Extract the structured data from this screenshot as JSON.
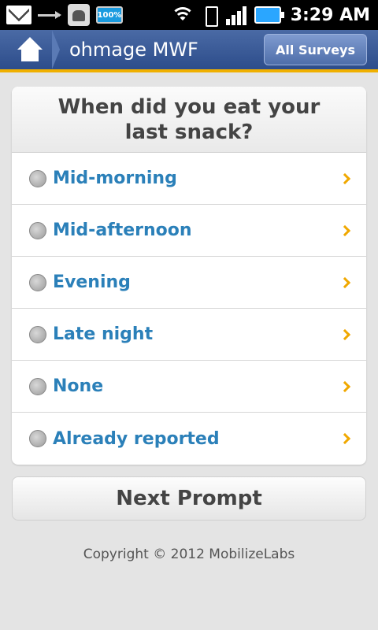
{
  "status_bar": {
    "time": "3:29 AM",
    "battery_small": "100%",
    "icons": [
      "gmail-icon",
      "usb-icon",
      "android-debug-icon",
      "battery-small-icon",
      "wifi-icon",
      "vibrate-icon",
      "signal-icon",
      "battery-icon"
    ]
  },
  "header": {
    "title": "ohmage MWF",
    "all_surveys_label": "All Surveys",
    "home_icon": "home-icon",
    "accent_color": "#f0b000",
    "bar_color": "#2d4d8b"
  },
  "question": {
    "text": "When did you eat your last snack?",
    "options": [
      {
        "label": "Mid-morning"
      },
      {
        "label": "Mid-afternoon"
      },
      {
        "label": "Evening"
      },
      {
        "label": "Late night"
      },
      {
        "label": "None"
      },
      {
        "label": "Already reported"
      }
    ],
    "option_color": "#2b80b9",
    "chevron_color": "#f0a800"
  },
  "next_label": "Next Prompt",
  "copyright": "Copyright © 2012 MobilizeLabs"
}
